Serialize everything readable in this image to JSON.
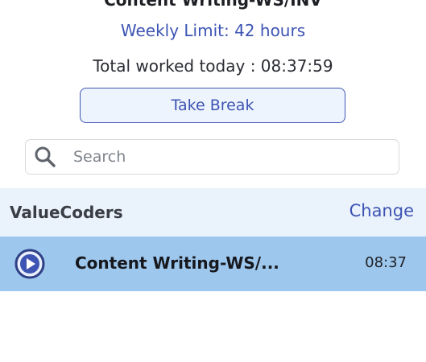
{
  "header": {
    "project_title": "Content Writing-WS/INV",
    "weekly_limit": "Weekly Limit: 42 hours",
    "total_worked": "Total worked today : 08:37:59"
  },
  "actions": {
    "take_break_label": "Take Break"
  },
  "search": {
    "placeholder": "Search",
    "value": ""
  },
  "client": {
    "name": "ValueCoders",
    "change_label": "Change"
  },
  "tasks": [
    {
      "name": "Content Writing-WS/...",
      "time": "08:37",
      "icon": "play-circle-icon",
      "selected": true
    }
  ],
  "colors": {
    "accent": "#3d54b3",
    "client_row_bg": "#eaf2fc",
    "selected_task_bg": "#9ec7ed"
  }
}
